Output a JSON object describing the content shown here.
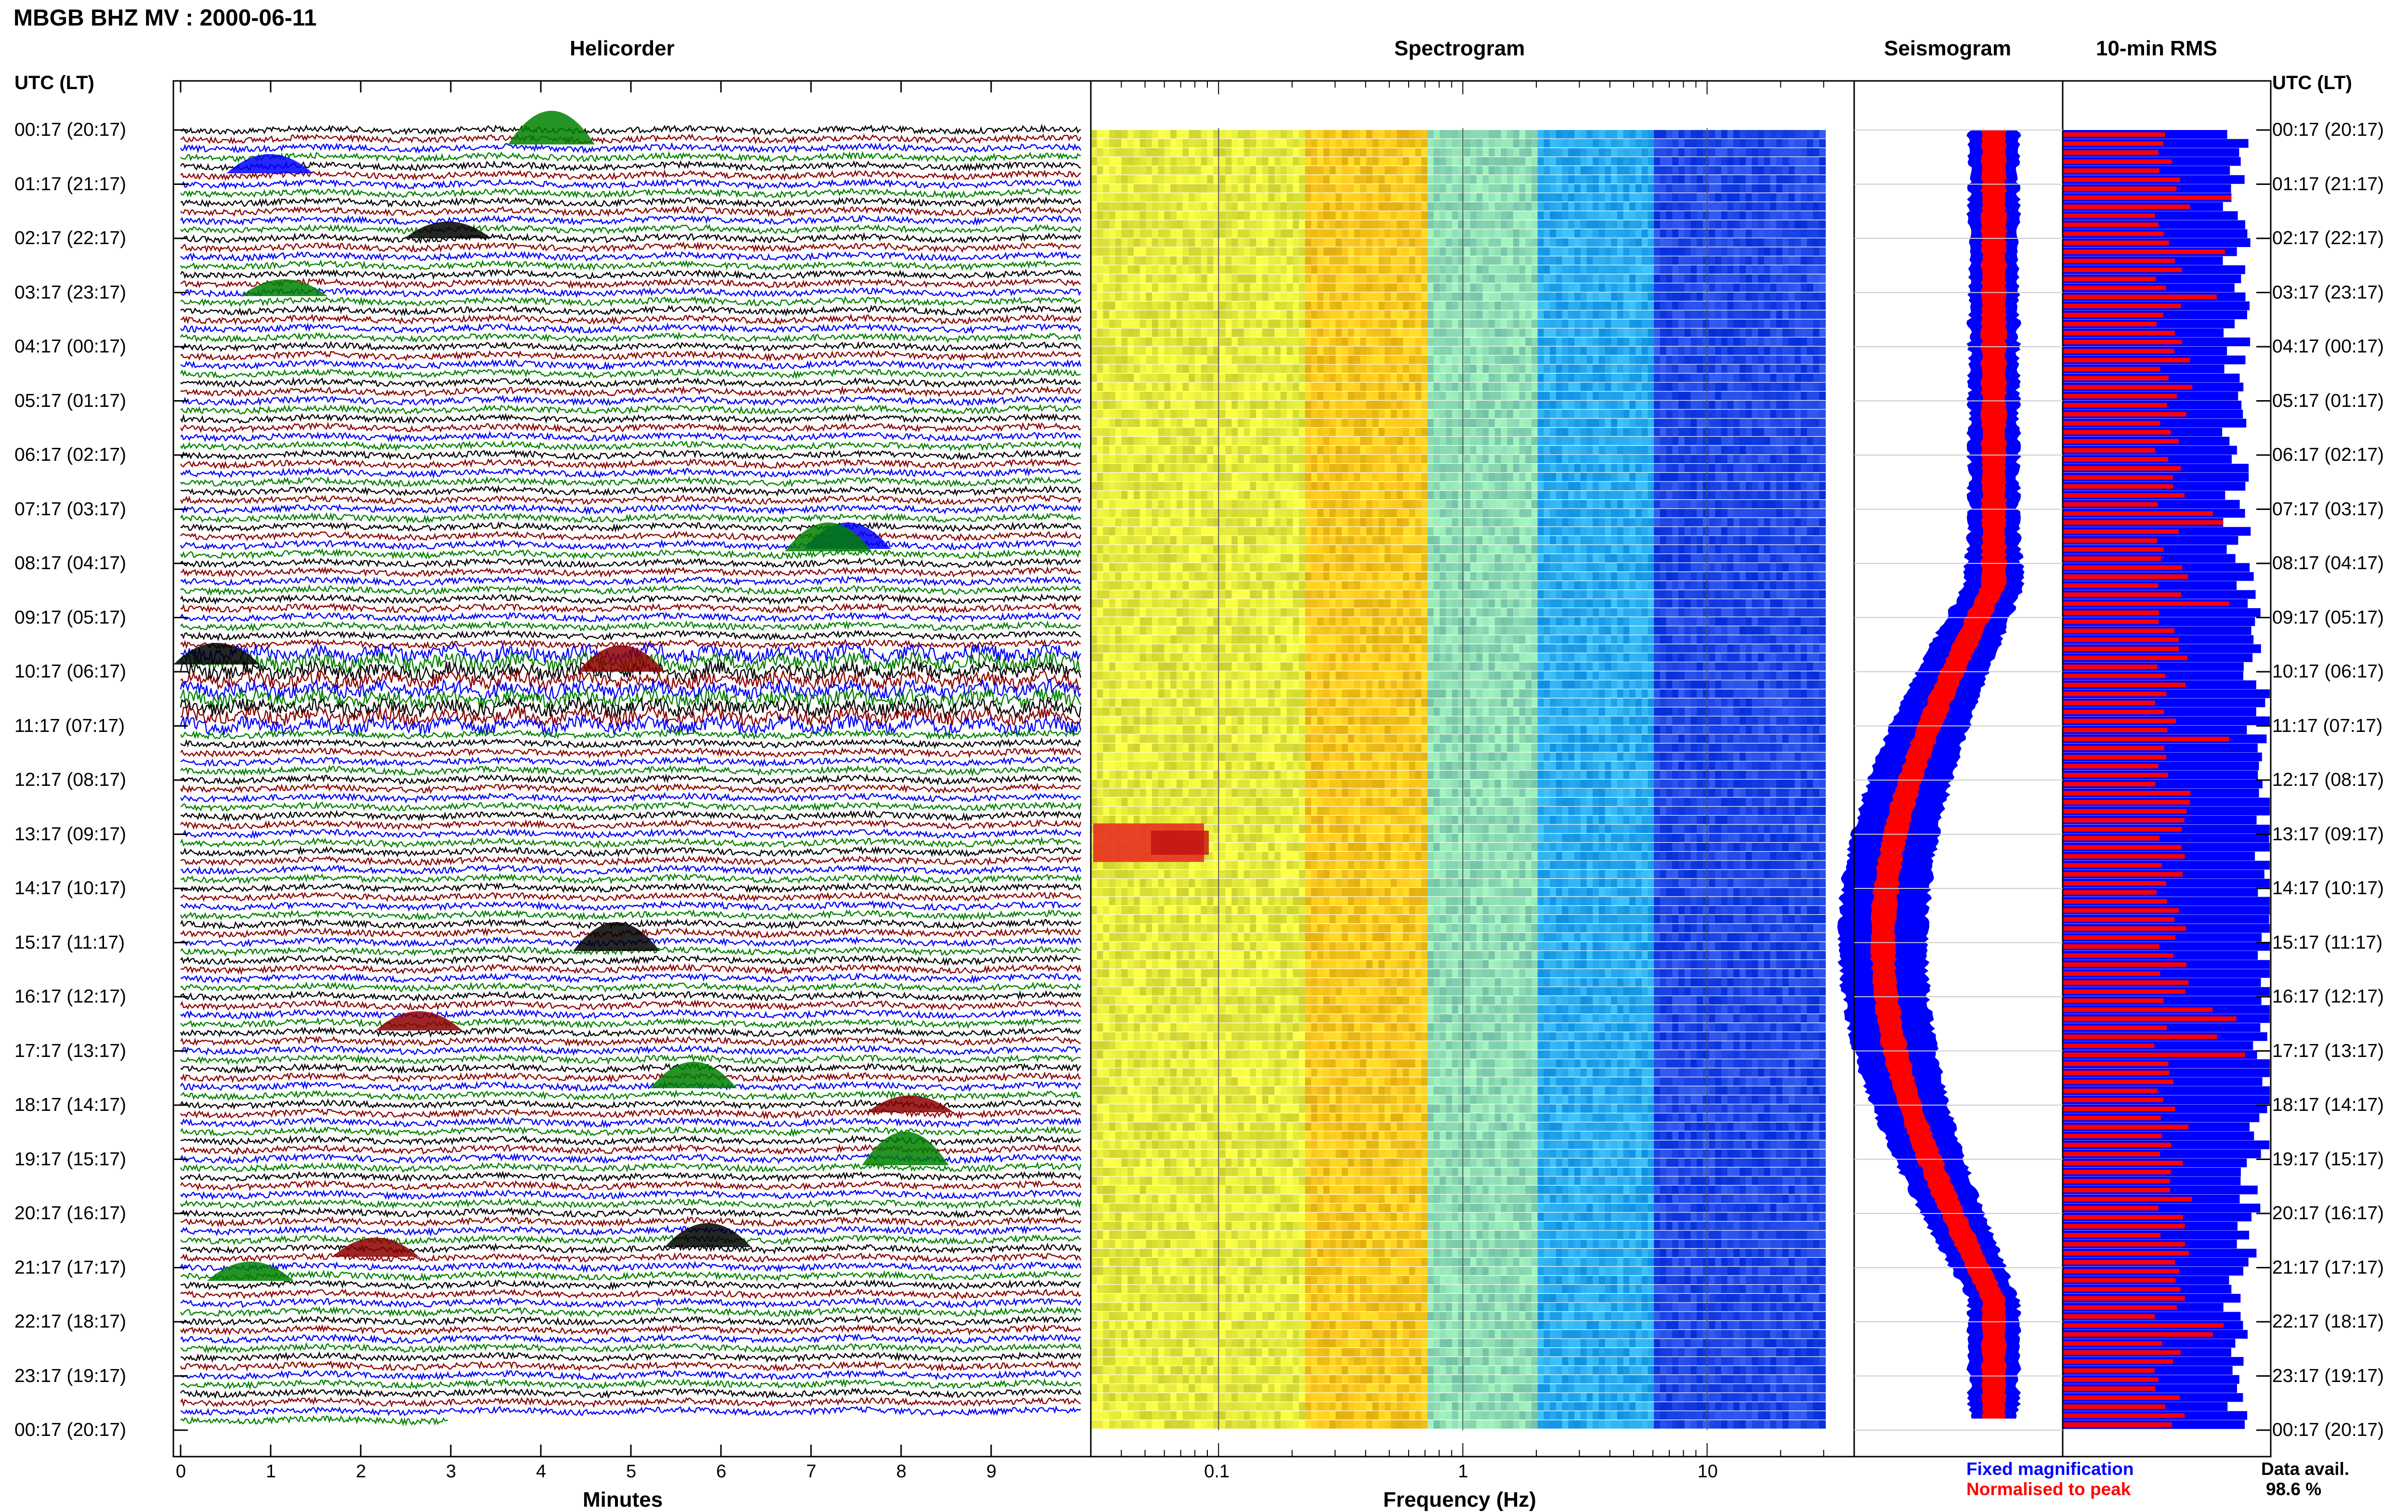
{
  "header": {
    "title": "MBGB BHZ MV : 2000-06-11",
    "utc_label_left": "UTC (LT)",
    "utc_label_right": "UTC (LT)"
  },
  "panels": {
    "helicorder": "Helicorder",
    "spectrogram": "Spectrogram",
    "seismogram": "Seismogram",
    "rms": "10-min RMS"
  },
  "time_labels": [
    "00:17 (20:17)",
    "01:17 (21:17)",
    "02:17 (22:17)",
    "03:17 (23:17)",
    "04:17 (00:17)",
    "05:17 (01:17)",
    "06:17 (02:17)",
    "07:17 (03:17)",
    "08:17 (04:17)",
    "09:17 (05:17)",
    "10:17 (06:17)",
    "11:17 (07:17)",
    "12:17 (08:17)",
    "13:17 (09:17)",
    "14:17 (10:17)",
    "15:17 (11:17)",
    "16:17 (12:17)",
    "17:17 (13:17)",
    "18:17 (14:17)",
    "19:17 (15:17)",
    "20:17 (16:17)",
    "21:17 (17:17)",
    "22:17 (18:17)",
    "23:17 (19:17)",
    "00:17 (20:17)"
  ],
  "helicorder_axis": {
    "ticks": [
      "0",
      "1",
      "2",
      "3",
      "4",
      "5",
      "6",
      "7",
      "8",
      "9"
    ],
    "label": "Minutes"
  },
  "spectrogram_axis": {
    "ticks": [
      "0.1",
      "1",
      "10"
    ],
    "label": "Frequency (Hz)"
  },
  "legend": {
    "fixed": "Fixed magnification",
    "normalised": "Normalised to peak",
    "fixed_color": "#0000ff",
    "normalised_color": "#ff0000"
  },
  "data_avail": {
    "label": "Data avail.",
    "value": "98.6 %"
  },
  "chart_data": [
    {
      "type": "line",
      "name": "Helicorder",
      "xlabel": "Minutes",
      "xlim": [
        0,
        10
      ],
      "trace_colors": [
        "#000000",
        "#8b0000",
        "#0000ff",
        "#008000"
      ]
    },
    {
      "type": "heatmap",
      "name": "Spectrogram",
      "xlabel": "Frequency (Hz)",
      "xscale": "log",
      "xlim": [
        0.03,
        40
      ]
    },
    {
      "type": "area",
      "name": "Seismogram",
      "series": [
        {
          "name": "Fixed magnification",
          "color": "#0000ff"
        },
        {
          "name": "Normalised to peak",
          "color": "#ff0000"
        }
      ]
    },
    {
      "type": "bar",
      "name": "10-min RMS",
      "series": [
        {
          "name": "Fixed magnification",
          "color": "#0000ff"
        },
        {
          "name": "Normalised to peak",
          "color": "#ff0000"
        }
      ]
    }
  ]
}
